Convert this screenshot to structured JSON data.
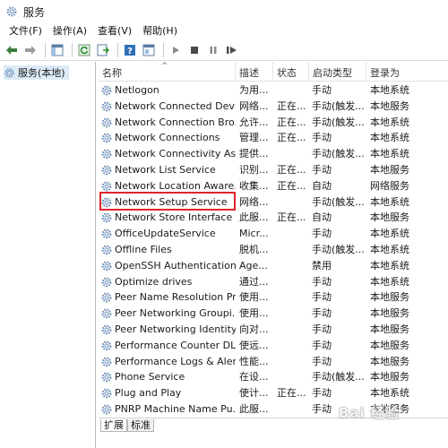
{
  "window": {
    "title": "服务"
  },
  "menu": [
    {
      "id": "file",
      "label": "文件(F)"
    },
    {
      "id": "action",
      "label": "操作(A)"
    },
    {
      "id": "view",
      "label": "查看(V)"
    },
    {
      "id": "help",
      "label": "帮助(H)"
    }
  ],
  "tree": {
    "label": "服务(本地)"
  },
  "columns": {
    "name": "名称",
    "description": "描述",
    "status": "状态",
    "startup": "启动类型",
    "logon": "登录为"
  },
  "rows": [
    {
      "name": "Netlogon",
      "description": "为用...",
      "status": "",
      "startup": "手动",
      "logon": "本地系统"
    },
    {
      "name": "Network Connected Devi...",
      "description": "网络...",
      "status": "正在...",
      "startup": "手动(触发...",
      "logon": "本地服务"
    },
    {
      "name": "Network Connection Bro...",
      "description": "允许...",
      "status": "正在...",
      "startup": "手动(触发...",
      "logon": "本地系统"
    },
    {
      "name": "Network Connections",
      "description": "管理...",
      "status": "正在...",
      "startup": "手动",
      "logon": "本地系统"
    },
    {
      "name": "Network Connectivity Ass...",
      "description": "提供...",
      "status": "",
      "startup": "手动(触发...",
      "logon": "本地系统"
    },
    {
      "name": "Network List Service",
      "description": "识别...",
      "status": "正在...",
      "startup": "手动",
      "logon": "本地服务"
    },
    {
      "name": "Network Location Aware...",
      "description": "收集...",
      "status": "正在...",
      "startup": "自动",
      "logon": "网络服务"
    },
    {
      "name": "Network Setup Service",
      "description": "网络...",
      "status": "",
      "startup": "手动(触发...",
      "logon": "本地系统"
    },
    {
      "name": "Network Store Interface ...",
      "description": "此服...",
      "status": "正在...",
      "startup": "自动",
      "logon": "本地服务"
    },
    {
      "name": "OfficeUpdateService",
      "description": "Micr...",
      "status": "",
      "startup": "手动",
      "logon": "本地系统"
    },
    {
      "name": "Offline Files",
      "description": "脱机...",
      "status": "",
      "startup": "手动(触发...",
      "logon": "本地系统"
    },
    {
      "name": "OpenSSH Authentication ...",
      "description": "Age...",
      "status": "",
      "startup": "禁用",
      "logon": "本地系统"
    },
    {
      "name": "Optimize drives",
      "description": "通过...",
      "status": "",
      "startup": "手动",
      "logon": "本地系统"
    },
    {
      "name": "Peer Name Resolution Pr...",
      "description": "使用...",
      "status": "",
      "startup": "手动",
      "logon": "本地服务"
    },
    {
      "name": "Peer Networking Groupi...",
      "description": "使用...",
      "status": "",
      "startup": "手动",
      "logon": "本地服务"
    },
    {
      "name": "Peer Networking Identity...",
      "description": "向对...",
      "status": "",
      "startup": "手动",
      "logon": "本地服务"
    },
    {
      "name": "Performance Counter DL...",
      "description": "使远...",
      "status": "",
      "startup": "手动",
      "logon": "本地服务"
    },
    {
      "name": "Performance Logs & Aler...",
      "description": "性能...",
      "status": "",
      "startup": "手动",
      "logon": "本地服务"
    },
    {
      "name": "Phone Service",
      "description": "在设...",
      "status": "",
      "startup": "手动(触发...",
      "logon": "本地服务"
    },
    {
      "name": "Plug and Play",
      "description": "使计...",
      "status": "正在...",
      "startup": "手动",
      "logon": "本地系统"
    },
    {
      "name": "PNRP Machine Name Pu...",
      "description": "此服...",
      "status": "",
      "startup": "手动",
      "logon": "本地服务"
    }
  ],
  "tabs": {
    "extended": "扩展",
    "standard": "标准"
  },
  "watermark": {
    "text": "Bai 经验"
  },
  "colors": {
    "highlight": "#e0232b",
    "selection": "#dcebf7"
  }
}
